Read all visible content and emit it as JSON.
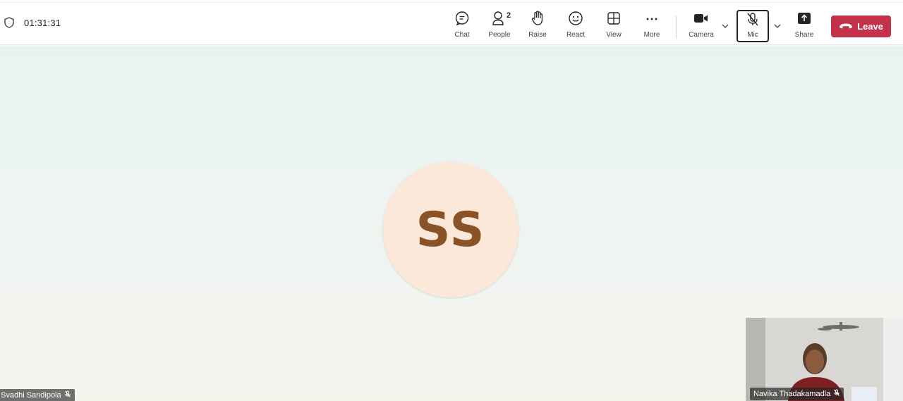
{
  "meeting": {
    "timer": "01:31:31"
  },
  "toolbar": {
    "chat": "Chat",
    "people": "People",
    "people_count": "2",
    "raise": "Raise",
    "react": "React",
    "view": "View",
    "more": "More",
    "camera": "Camera",
    "mic": "Mic",
    "share": "Share",
    "leave": "Leave"
  },
  "stage": {
    "main_participant": {
      "initials": "SS",
      "name": "Svadhi Sandipola"
    },
    "pip_participant": {
      "name": "Navika Thadakamadla"
    }
  },
  "colors": {
    "leave": "#c4314b",
    "avatar_bg": "#fbe8d8",
    "avatar_text": "#8a5327"
  },
  "icons": [
    "shield-icon",
    "chat-icon",
    "people-icon",
    "raise-hand-icon",
    "react-icon",
    "view-icon",
    "more-icon",
    "camera-icon",
    "mic-muted-icon",
    "share-icon",
    "phone-hangup-icon",
    "chevron-down-icon"
  ]
}
